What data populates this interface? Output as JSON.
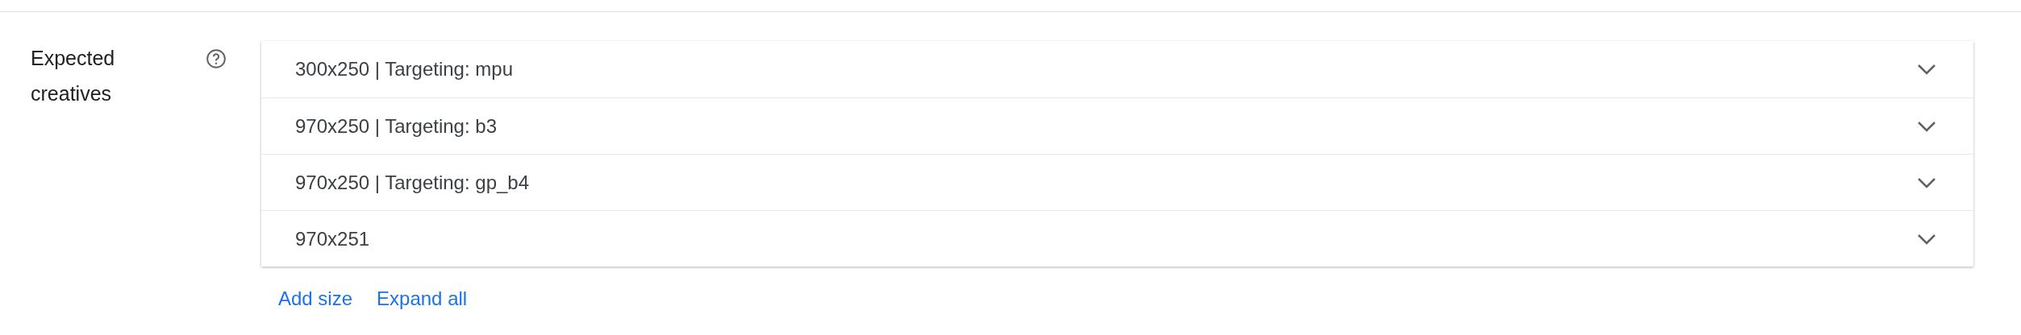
{
  "field": {
    "label": "Expected creatives"
  },
  "creatives": [
    {
      "title": "300x250 | Targeting: mpu",
      "expanded": false
    },
    {
      "title": "970x250 | Targeting: b3",
      "expanded": false
    },
    {
      "title": "970x250 | Targeting: gp_b4",
      "expanded": false
    },
    {
      "title": "970x251",
      "expanded": false
    }
  ],
  "actions": [
    "Add size",
    "Expand all"
  ]
}
